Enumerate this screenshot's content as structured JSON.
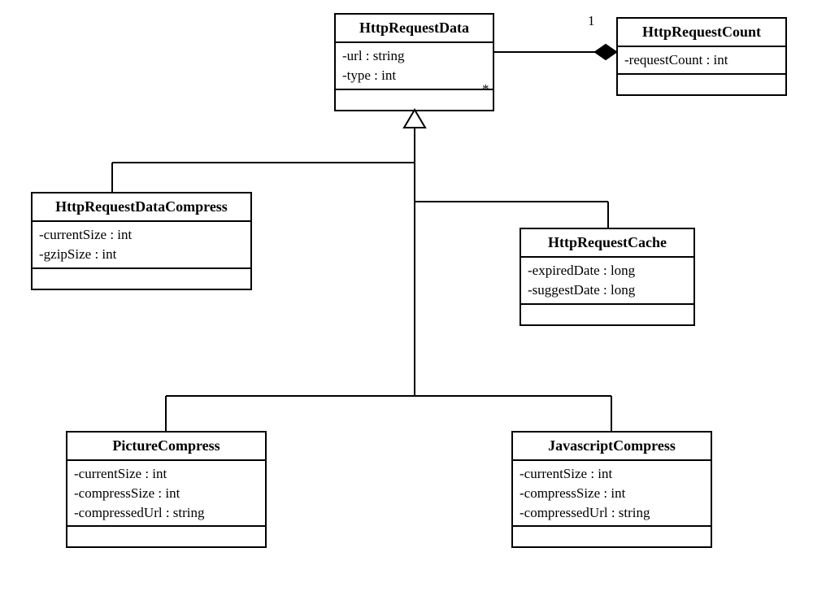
{
  "classes": {
    "httpRequestData": {
      "name": "HttpRequestData",
      "attrs": [
        "-url : string",
        "-type : int"
      ]
    },
    "httpRequestCount": {
      "name": "HttpRequestCount",
      "attrs": [
        "-requestCount : int"
      ]
    },
    "httpRequestDataCompress": {
      "name": "HttpRequestDataCompress",
      "attrs": [
        "-currentSize : int",
        "-gzipSize : int"
      ]
    },
    "httpRequestCache": {
      "name": "HttpRequestCache",
      "attrs": [
        "-expiredDate : long",
        "-suggestDate : long"
      ]
    },
    "pictureCompress": {
      "name": "PictureCompress",
      "attrs": [
        "-currentSize : int",
        "-compressSize : int",
        "-compressedUrl : string"
      ]
    },
    "javascriptCompress": {
      "name": "JavascriptCompress",
      "attrs": [
        "-currentSize : int",
        "-compressSize : int",
        "-compressedUrl : string"
      ]
    }
  },
  "multiplicities": {
    "countSide": "1",
    "dataSide": "*"
  }
}
